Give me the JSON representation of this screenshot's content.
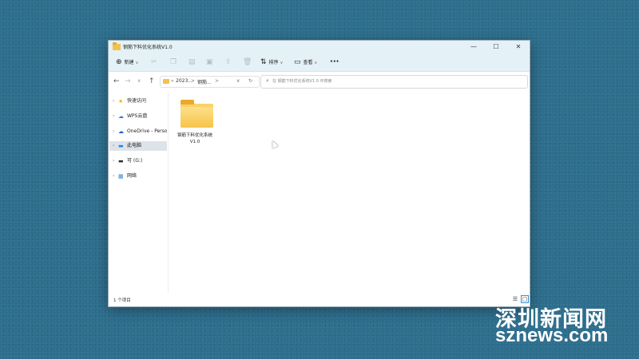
{
  "window": {
    "title": "钢筋下料优化系统V1.0",
    "controls": {
      "minimize": "—",
      "maximize": "☐",
      "close": "✕"
    }
  },
  "toolbar": {
    "new_label": "新建",
    "sort_label": "排序",
    "view_label": "查看",
    "more_label": "•••"
  },
  "address": {
    "segment_1": "2023...",
    "segment_2": "钢筋...",
    "separator": ">",
    "overflow": "«",
    "dropdown": "∨",
    "refresh": "↻"
  },
  "search": {
    "placeholder": "在 钢筋下料优化系统V1.0 中搜索"
  },
  "sidebar": {
    "items": [
      {
        "label": "快速访问",
        "icon": "star-icon"
      },
      {
        "label": "WPS云盘",
        "icon": "cloud-icon"
      },
      {
        "label": "OneDrive - Personal",
        "icon": "onedrive-icon"
      },
      {
        "label": "此电脑",
        "icon": "computer-icon"
      },
      {
        "label": "可 (G:)",
        "icon": "drive-icon"
      },
      {
        "label": "网络",
        "icon": "network-icon"
      }
    ]
  },
  "content": {
    "items": [
      {
        "name": "钢筋下料优化系统V1.0",
        "type": "folder"
      }
    ]
  },
  "status": {
    "count": "1 个项目"
  },
  "watermark": {
    "cn": "深圳新闻网",
    "en": "sznews.com"
  },
  "colors": {
    "desktop": "#2e6f8e",
    "titlebar": "#e4f1f6",
    "folder": "#f4b93a",
    "selected": "#dde3e8"
  }
}
